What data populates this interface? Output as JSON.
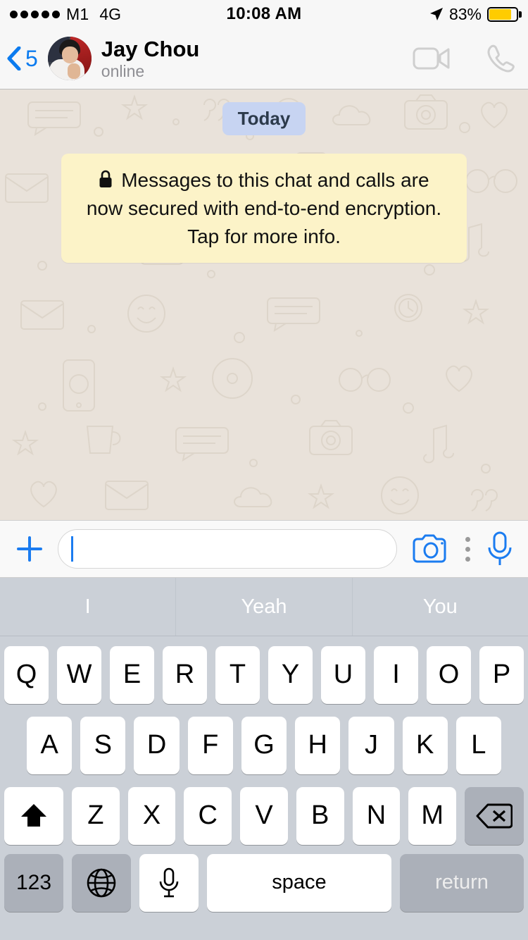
{
  "status_bar": {
    "signal_dots": 5,
    "carrier": "M1",
    "network": "4G",
    "time": "10:08 AM",
    "battery_percent": "83%",
    "battery_level": 83,
    "battery_color": "#FFCC00",
    "location_icon": "location-arrow-icon"
  },
  "header": {
    "back_icon": "chevron-left-icon",
    "back_count": "5",
    "avatar_icon": "contact-avatar",
    "contact_name": "Jay Chou",
    "contact_status": "online",
    "video_call_icon": "video-camera-icon",
    "voice_call_icon": "phone-handset-icon",
    "accent_color": "#0B7BEF"
  },
  "chat": {
    "day_divider": "Today",
    "day_pill_color": "#C7D4F2",
    "encryption_notice": "Messages to this chat and calls are now secured with end-to-end encryption. Tap for more info.",
    "encryption_icon": "lock-icon",
    "encryption_bubble_color": "#FCF3C8",
    "wallpaper": "whatsapp-doodle-pattern",
    "wallpaper_color": "#E9E2DA"
  },
  "input_bar": {
    "attach_icon": "plus-icon",
    "message_value": "",
    "message_placeholder": "",
    "camera_icon": "camera-icon",
    "more_icon": "kebab-menu-icon",
    "mic_icon": "microphone-icon"
  },
  "keyboard": {
    "predictions": [
      "I",
      "Yeah",
      "You"
    ],
    "row1": [
      "Q",
      "W",
      "E",
      "R",
      "T",
      "Y",
      "U",
      "I",
      "O",
      "P"
    ],
    "row2": [
      "A",
      "S",
      "D",
      "F",
      "G",
      "H",
      "J",
      "K",
      "L"
    ],
    "row3": [
      "Z",
      "X",
      "C",
      "V",
      "B",
      "N",
      "M"
    ],
    "shift_icon": "shift-arrow-icon",
    "backspace_icon": "backspace-icon",
    "numbers_label": "123",
    "globe_icon": "globe-icon",
    "dictation_icon": "microphone-icon",
    "space_label": "space",
    "return_label": "return"
  }
}
